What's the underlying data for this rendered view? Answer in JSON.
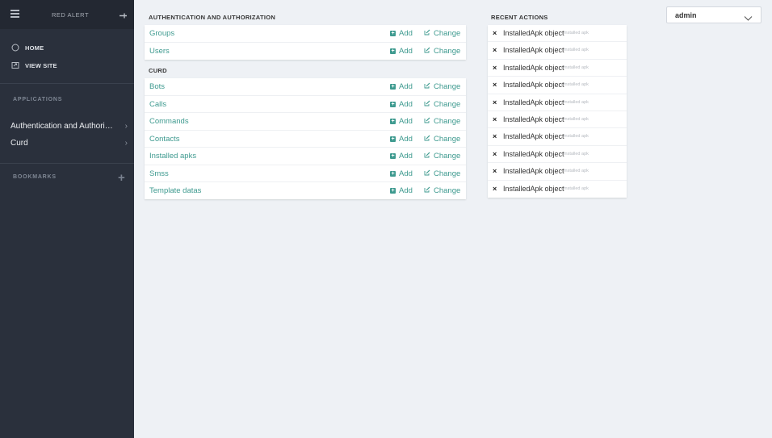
{
  "sidebar": {
    "brand": "RED ALERT",
    "nav": [
      {
        "label": "HOME",
        "icon": "home-icon"
      },
      {
        "label": "VIEW SITE",
        "icon": "view-site-icon"
      }
    ],
    "applications_title": "APPLICATIONS",
    "apps": [
      {
        "label": "Authentication and Authorization"
      },
      {
        "label": "Curd"
      }
    ],
    "bookmarks_title": "BOOKMARKS"
  },
  "modules": [
    {
      "title": "AUTHENTICATION AND AUTHORIZATION",
      "models": [
        "Groups",
        "Users"
      ]
    },
    {
      "title": "CURD",
      "models": [
        "Bots",
        "Calls",
        "Commands",
        "Contacts",
        "Installed apks",
        "Smss",
        "Template datas"
      ]
    }
  ],
  "actions": {
    "add": "Add",
    "change": "Change"
  },
  "recent": {
    "title": "RECENT ACTIONS",
    "items": [
      {
        "name": "InstalledApk object",
        "type": "Installed apk"
      },
      {
        "name": "InstalledApk object",
        "type": "Installed apk"
      },
      {
        "name": "InstalledApk object",
        "type": "Installed apk"
      },
      {
        "name": "InstalledApk object",
        "type": "Installed apk"
      },
      {
        "name": "InstalledApk object",
        "type": "Installed apk"
      },
      {
        "name": "InstalledApk object",
        "type": "Installed apk"
      },
      {
        "name": "InstalledApk object",
        "type": "Installed apk"
      },
      {
        "name": "InstalledApk object",
        "type": "Installed apk"
      },
      {
        "name": "InstalledApk object",
        "type": "Installed apk"
      },
      {
        "name": "InstalledApk object",
        "type": "Installed apk"
      }
    ]
  },
  "user": {
    "name": "admin"
  },
  "colors": {
    "accent": "#3e9a8f",
    "sidebar": "#2a303c",
    "background": "#eef1f5"
  }
}
